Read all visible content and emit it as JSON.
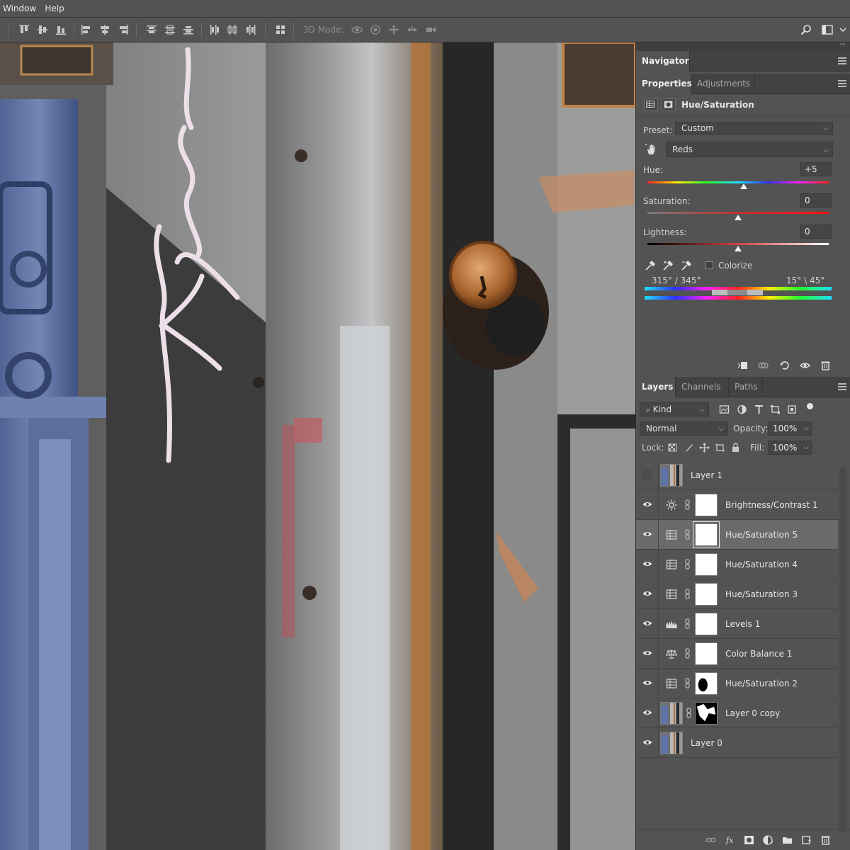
{
  "menubar": {
    "items": [
      "Window",
      "Help"
    ]
  },
  "optionsbar": {
    "mode_label": "3D Mode:",
    "align_icons": [
      "align-top-icon",
      "align-vcenter-icon",
      "align-bottom-icon",
      "align-left-icon",
      "align-hcenter-icon",
      "align-right-icon"
    ],
    "distribute_icons": [
      "distribute-top-icon",
      "distribute-vcenter-icon",
      "distribute-bottom-icon",
      "distribute-left-icon",
      "distribute-hcenter-icon",
      "distribute-right-icon"
    ],
    "mode_icons": [
      "3d-orbit-icon",
      "3d-roll-icon",
      "3d-pan-icon",
      "3d-slide-icon",
      "3d-scale-icon"
    ]
  },
  "navigator": {
    "tab": "Navigator"
  },
  "properties": {
    "tabs": [
      "Properties",
      "Adjustments"
    ],
    "title": "Hue/Saturation",
    "preset_label": "Preset:",
    "preset_value": "Custom",
    "channel_value": "Reds",
    "hue_label": "Hue:",
    "hue_value": "+5",
    "hue_level_percent": 53,
    "saturation_label": "Saturation:",
    "saturation_value": "0",
    "saturation_level_percent": 50,
    "lightness_label": "Lightness:",
    "lightness_value": "0",
    "lightness_level_percent": 50,
    "colorize_label": "Colorize",
    "colorize_checked": false,
    "range_left": "315° / 345°",
    "range_right": "15° \\ 45°"
  },
  "layers_panel": {
    "tabs": [
      "Layers",
      "Channels",
      "Paths"
    ],
    "filter_kind": "Kind",
    "blend_mode": "Normal",
    "opacity_label": "Opacity:",
    "opacity_value": "100%",
    "lock_label": "Lock:",
    "fill_label": "Fill:",
    "fill_value": "100%",
    "layers": [
      {
        "name": "Layer 1",
        "visible": false,
        "type": "image"
      },
      {
        "name": "Brightness/Contrast 1",
        "visible": true,
        "type": "brightness"
      },
      {
        "name": "Hue/Saturation 5",
        "visible": true,
        "type": "huesat",
        "selected": true
      },
      {
        "name": "Hue/Saturation 4",
        "visible": true,
        "type": "huesat"
      },
      {
        "name": "Hue/Saturation 3",
        "visible": true,
        "type": "huesat"
      },
      {
        "name": "Levels 1",
        "visible": true,
        "type": "levels"
      },
      {
        "name": "Color Balance 1",
        "visible": true,
        "type": "colorbalance"
      },
      {
        "name": "Hue/Saturation 2",
        "visible": true,
        "type": "huesat",
        "mask": "dark"
      },
      {
        "name": "Layer 0 copy",
        "visible": true,
        "type": "image",
        "mask": "bw"
      },
      {
        "name": "Layer 0",
        "visible": true,
        "type": "image"
      }
    ]
  }
}
